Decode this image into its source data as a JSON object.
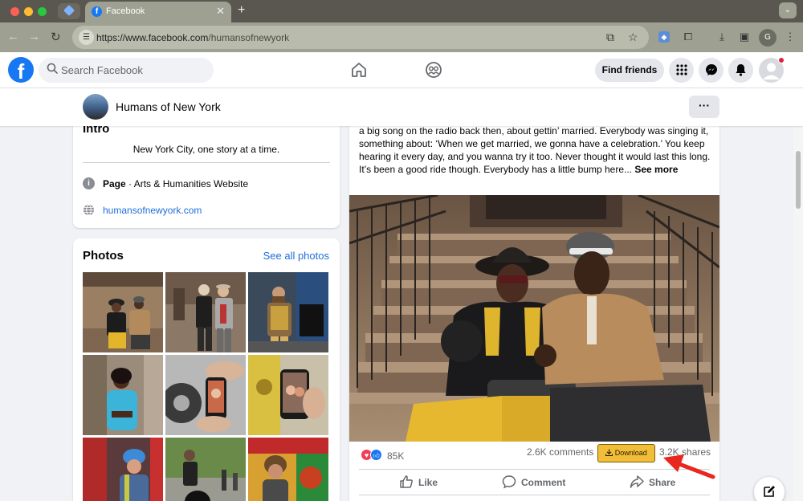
{
  "browser": {
    "tab_title": "Facebook",
    "url_host": "https://www.facebook.com",
    "url_path": "/humansofnewyork",
    "profile_initial": "G",
    "accent": "#9ea191"
  },
  "header": {
    "logo_letter": "f",
    "search_placeholder": "Search Facebook",
    "find_friends_label": "Find friends",
    "brand_color": "#1877f2"
  },
  "page": {
    "name": "Humans of New York",
    "more_label": "···"
  },
  "intro": {
    "title": "Intro",
    "bio": "New York City, one story at a time.",
    "category_label": "Page",
    "category_value": " · Arts & Humanities Website",
    "website": "humansofnewyork.com"
  },
  "photos": {
    "title": "Photos",
    "see_all_label": "See all photos"
  },
  "post": {
    "text": "a big song on the radio back then, about gettin’ married. Everybody was singing it, something about: ‘When we get married, we gonna have a celebration.’ You keep hearing it every day, and you wanna try it too. Never thought it would last this long. It’s been a good ride though. Everybody has a little bump here... ",
    "see_more": "See more",
    "reaction_count": "85K",
    "comments": "2.6K comments",
    "download_label": "Download",
    "shares": "3.2K shares",
    "actions": {
      "like": "Like",
      "comment": "Comment",
      "share": "Share"
    }
  },
  "icons": {
    "search": "search-icon",
    "home": "home-icon",
    "groups": "groups-icon",
    "menu": "menu-grid-icon",
    "messenger": "messenger-icon",
    "bell": "bell-icon",
    "compose": "compose-icon"
  }
}
